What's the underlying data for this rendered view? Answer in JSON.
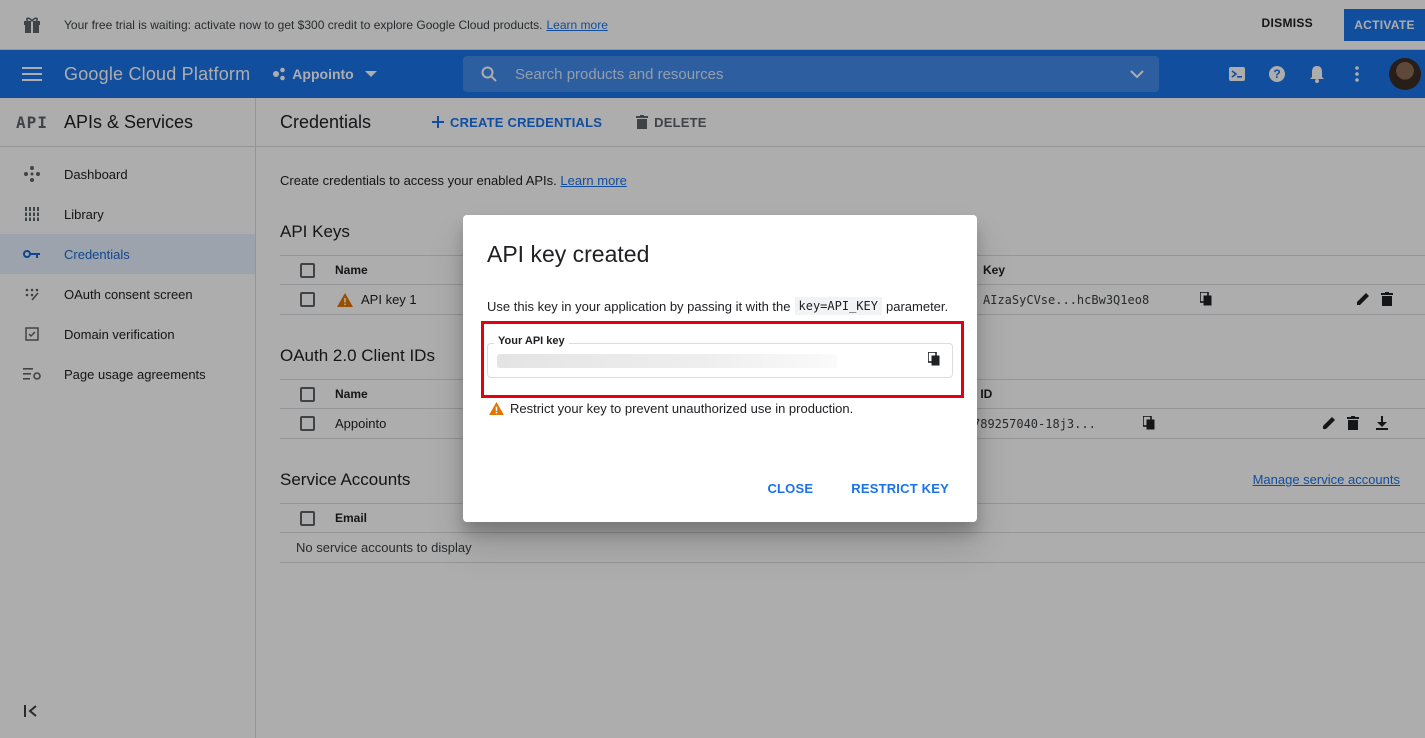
{
  "banner": {
    "message": "Your free trial is waiting: activate now to get $300 credit to explore Google Cloud products.",
    "learn_more": "Learn more",
    "dismiss": "DISMISS",
    "activate": "ACTIVATE"
  },
  "appbar": {
    "brand": "Google Cloud Platform",
    "project": "Appointo",
    "search_placeholder": "Search products and resources"
  },
  "sidebar": {
    "section_badge": "API",
    "title": "APIs & Services",
    "items": [
      {
        "label": "Dashboard"
      },
      {
        "label": "Library"
      },
      {
        "label": "Credentials"
      },
      {
        "label": "OAuth consent screen"
      },
      {
        "label": "Domain verification"
      },
      {
        "label": "Page usage agreements"
      }
    ]
  },
  "main": {
    "title": "Credentials",
    "create_label": "CREATE CREDENTIALS",
    "delete_label": "DELETE",
    "intro": "Create credentials to access your enabled APIs.",
    "intro_link": "Learn more",
    "api_keys": {
      "title": "API Keys",
      "col_name": "Name",
      "col_key": "Key",
      "rows": [
        {
          "name": "API key 1",
          "key": "AIzaSyCVse...hcBw3Q1eo8"
        }
      ]
    },
    "oauth": {
      "title": "OAuth 2.0 Client IDs",
      "col_name": "Name",
      "col_client_id": "t ID",
      "rows": [
        {
          "name": "Appointo",
          "client_id": "789257040-18j3..."
        }
      ]
    },
    "service_accounts": {
      "title": "Service Accounts",
      "manage_link": "Manage service accounts",
      "col_email": "Email",
      "empty": "No service accounts to display"
    }
  },
  "dialog": {
    "title": "API key created",
    "desc_before": "Use this key in your application by passing it with the",
    "desc_code": "key=API_KEY",
    "desc_after": "parameter.",
    "field_label": "Your API key",
    "warning": "Restrict your key to prevent unauthorized use in production.",
    "close": "CLOSE",
    "restrict": "RESTRICT KEY"
  },
  "colors": {
    "primary": "#1a73e8",
    "highlight": "#e3000f",
    "warning": "#e37400"
  }
}
